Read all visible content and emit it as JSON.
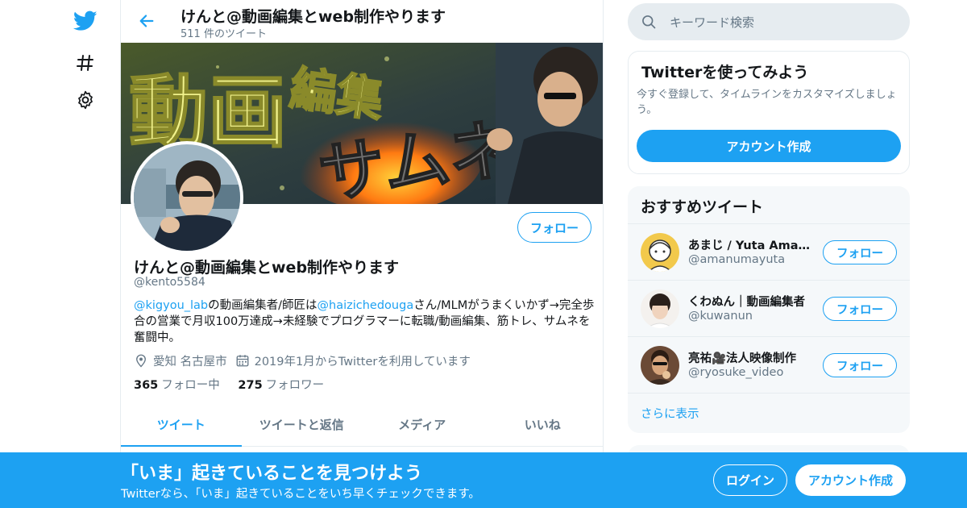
{
  "colors": {
    "accent": "#1da1f2",
    "muted": "#657786",
    "text": "#14171a",
    "border": "#e6ecf0"
  },
  "nav": {
    "icons": [
      "twitter-logo-icon",
      "hashtag-icon",
      "gear-icon"
    ]
  },
  "header": {
    "title": "けんと@動画編集とweb制作やります",
    "tweet_count": "511 件のツイート"
  },
  "profile": {
    "name": "けんと@動画編集とweb制作やります",
    "handle": "@kento5584",
    "follow_label": "フォロー",
    "bio": {
      "link1": "@kigyou_lab",
      "text1": "の動画編集者/師匠は",
      "link2": "@haizichedouga",
      "text2": "さん/MLMがうまくいかず→完全歩合の営業で月収100万達成→未経験でプログラマーに転職/動画編集、筋トレ、サムネを奮闘中。"
    },
    "location": "愛知 名古屋市",
    "joined": "2019年1月からTwitterを利用しています",
    "following_count": "365",
    "following_label": "フォロー中",
    "followers_count": "275",
    "followers_label": "フォロワー"
  },
  "tabs": [
    {
      "label": "ツイート",
      "active": true
    },
    {
      "label": "ツイートと返信",
      "active": false
    },
    {
      "label": "メディア",
      "active": false
    },
    {
      "label": "いいね",
      "active": false
    }
  ],
  "search": {
    "placeholder": "キーワード検索"
  },
  "signup_box": {
    "title": "Twitterを使ってみよう",
    "description": "今すぐ登録して、タイムラインをカスタマイズしましょう。",
    "button": "アカウント作成"
  },
  "recommended": {
    "title": "おすすめツイート",
    "items": [
      {
        "name": "あまじ / Yuta Amanuma",
        "handle": "@amanumayuta",
        "follow": "フォロー"
      },
      {
        "name": "くわぬん｜動画編集者",
        "handle": "@kuwanun",
        "follow": "フォロー"
      },
      {
        "name": "亮祐🎥法人映像制作",
        "handle": "@ryosuke_video",
        "follow": "フォロー"
      }
    ],
    "more": "さらに表示"
  },
  "bottom_banner": {
    "title": "「いま」起きていることを見つけよう",
    "subtitle": "Twitterなら、「いま」起きていることをいち早くチェックできます。",
    "login": "ログイン",
    "signup": "アカウント作成"
  }
}
